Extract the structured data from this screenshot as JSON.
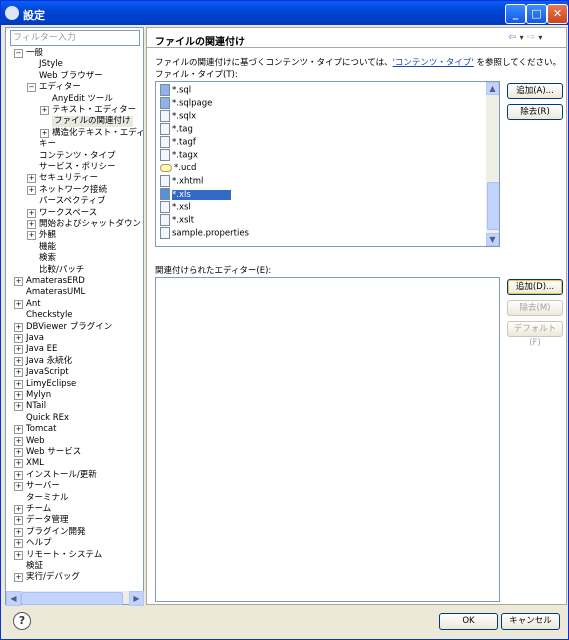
{
  "window": {
    "title": "設定"
  },
  "filter": {
    "placeholder": "フィルター入力"
  },
  "tree": {
    "items": [
      {
        "label": "一般",
        "indent": 0,
        "expander": "−"
      },
      {
        "label": "JStyle",
        "indent": 1,
        "expander": ""
      },
      {
        "label": "Web ブラウザー",
        "indent": 1,
        "expander": ""
      },
      {
        "label": "エディター",
        "indent": 1,
        "expander": "−"
      },
      {
        "label": "AnyEdit ツール",
        "indent": 2,
        "expander": ""
      },
      {
        "label": "テキスト・エディター",
        "indent": 2,
        "expander": "+"
      },
      {
        "label": "ファイルの関連付け",
        "indent": 2,
        "expander": "",
        "selected": true
      },
      {
        "label": "構造化テキスト・エディ",
        "indent": 2,
        "expander": "+"
      },
      {
        "label": "キー",
        "indent": 1,
        "expander": ""
      },
      {
        "label": "コンテンツ・タイプ",
        "indent": 1,
        "expander": ""
      },
      {
        "label": "サービス・ポリシー",
        "indent": 1,
        "expander": ""
      },
      {
        "label": "セキュリティー",
        "indent": 1,
        "expander": "+"
      },
      {
        "label": "ネットワーク接続",
        "indent": 1,
        "expander": "+"
      },
      {
        "label": "パースペクティブ",
        "indent": 1,
        "expander": ""
      },
      {
        "label": "ワークスペース",
        "indent": 1,
        "expander": "+"
      },
      {
        "label": "開始およびシャットダウン",
        "indent": 1,
        "expander": "+"
      },
      {
        "label": "外観",
        "indent": 1,
        "expander": "+"
      },
      {
        "label": "機能",
        "indent": 1,
        "expander": ""
      },
      {
        "label": "検索",
        "indent": 1,
        "expander": ""
      },
      {
        "label": "比較/パッチ",
        "indent": 1,
        "expander": ""
      },
      {
        "label": "AmaterasERD",
        "indent": 0,
        "expander": "+"
      },
      {
        "label": "AmaterasUML",
        "indent": 0,
        "expander": ""
      },
      {
        "label": "Ant",
        "indent": 0,
        "expander": "+"
      },
      {
        "label": "Checkstyle",
        "indent": 0,
        "expander": ""
      },
      {
        "label": "DBViewer プラグイン",
        "indent": 0,
        "expander": "+"
      },
      {
        "label": "Java",
        "indent": 0,
        "expander": "+"
      },
      {
        "label": "Java EE",
        "indent": 0,
        "expander": "+"
      },
      {
        "label": "Java 永続化",
        "indent": 0,
        "expander": "+"
      },
      {
        "label": "JavaScript",
        "indent": 0,
        "expander": "+"
      },
      {
        "label": "LimyEclipse",
        "indent": 0,
        "expander": "+"
      },
      {
        "label": "Mylyn",
        "indent": 0,
        "expander": "+"
      },
      {
        "label": "NTail",
        "indent": 0,
        "expander": "+"
      },
      {
        "label": "Quick REx",
        "indent": 0,
        "expander": ""
      },
      {
        "label": "Tomcat",
        "indent": 0,
        "expander": "+"
      },
      {
        "label": "Web",
        "indent": 0,
        "expander": "+"
      },
      {
        "label": "Web サービス",
        "indent": 0,
        "expander": "+"
      },
      {
        "label": "XML",
        "indent": 0,
        "expander": "+"
      },
      {
        "label": "インストール/更新",
        "indent": 0,
        "expander": "+"
      },
      {
        "label": "サーバー",
        "indent": 0,
        "expander": "+"
      },
      {
        "label": "ターミナル",
        "indent": 0,
        "expander": ""
      },
      {
        "label": "チーム",
        "indent": 0,
        "expander": "+"
      },
      {
        "label": "データ管理",
        "indent": 0,
        "expander": "+"
      },
      {
        "label": "プラグイン開発",
        "indent": 0,
        "expander": "+"
      },
      {
        "label": "ヘルプ",
        "indent": 0,
        "expander": "+"
      },
      {
        "label": "リモート・システム",
        "indent": 0,
        "expander": "+"
      },
      {
        "label": "検証",
        "indent": 0,
        "expander": ""
      },
      {
        "label": "実行/デバッグ",
        "indent": 0,
        "expander": "+"
      }
    ]
  },
  "page": {
    "title": "ファイルの関連付け",
    "description_before": "ファイルの関連付けに基づくコンテンツ・タイプについては、",
    "description_link": "'コンテンツ・タイプ'",
    "description_after": " を参照してください。",
    "file_types_label": "ファイル・タイプ(T):",
    "editors_label": "関連付けられたエディター(E):"
  },
  "file_types": [
    {
      "name": "*.sql",
      "icon": "sql-file-icon"
    },
    {
      "name": "*.sqlpage",
      "icon": "sql-file-icon"
    },
    {
      "name": "*.sqlx",
      "icon": "sqlx-file-icon"
    },
    {
      "name": "*.tag",
      "icon": "file-icon"
    },
    {
      "name": "*.tagf",
      "icon": "file-icon"
    },
    {
      "name": "*.tagx",
      "icon": "file-icon"
    },
    {
      "name": "*.ucd",
      "icon": "ucd-file-icon"
    },
    {
      "name": "*.xhtml",
      "icon": "file-icon"
    },
    {
      "name": "*.xls",
      "icon": "xls-file-icon",
      "selected": true
    },
    {
      "name": "*.xsl",
      "icon": "xsl-file-icon"
    },
    {
      "name": "*.xslt",
      "icon": "xsl-file-icon"
    },
    {
      "name": "sample.properties",
      "icon": "properties-file-icon"
    }
  ],
  "buttons": {
    "add_type": "追加(A)...",
    "remove_type": "除去(R)",
    "add_editor": "追加(D)...",
    "remove_editor": "除去(M)",
    "default": "デフォルト(F)",
    "ok": "OK",
    "cancel": "キャンセル"
  },
  "title_buttons": {
    "minimize": "_",
    "maximize": "□",
    "close": "✕"
  },
  "nav_icons": {
    "back": "⇦",
    "back_menu": "▾",
    "forward": "⇨",
    "forward_menu": "▾"
  },
  "misc": {
    "help": "?",
    "scroll_up": "▲",
    "scroll_down": "▼",
    "scroll_left": "◀",
    "scroll_right": "▶"
  }
}
